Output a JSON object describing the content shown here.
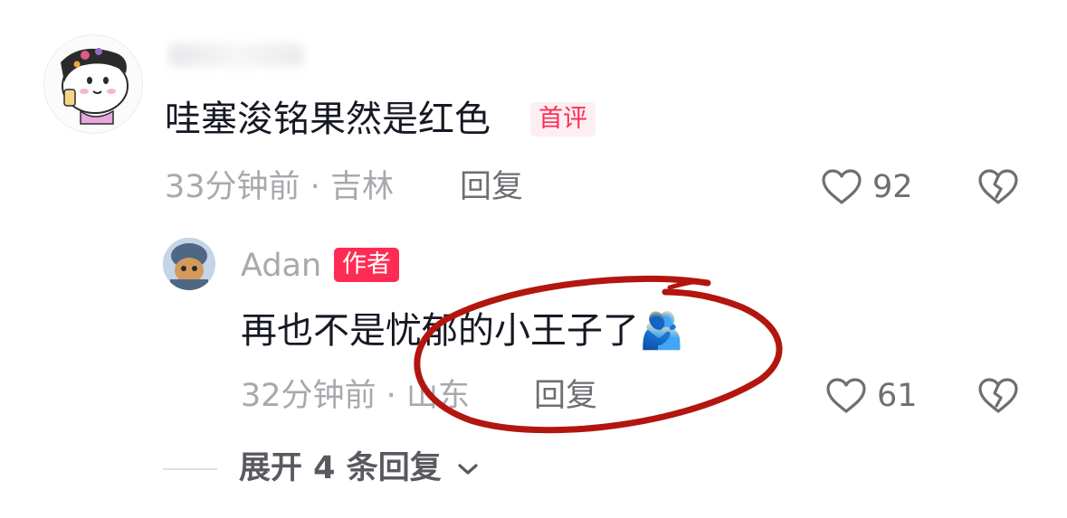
{
  "comments": [
    {
      "text": "哇塞浚铭果然是红色",
      "badge": "首评",
      "time": "33分钟前",
      "location": "吉林",
      "reply_label": "回复",
      "likes": "92",
      "avatar_icon": "cartoon-avatar-icon"
    },
    {
      "username": "Adan",
      "badge": "作者",
      "text": "再也不是忧郁的小王子了",
      "emoji": "🫂",
      "time": "32分钟前",
      "location": "山东",
      "reply_label": "回复",
      "likes": "61",
      "avatar_icon": "user-avatar-icon"
    }
  ],
  "expand_replies": {
    "label": "展开 4 条回复"
  },
  "colors": {
    "accent": "#fe2c55",
    "badge_bg": "#fdeef1",
    "meta_text": "#a8a8ad",
    "annotation": "#b3150f"
  }
}
